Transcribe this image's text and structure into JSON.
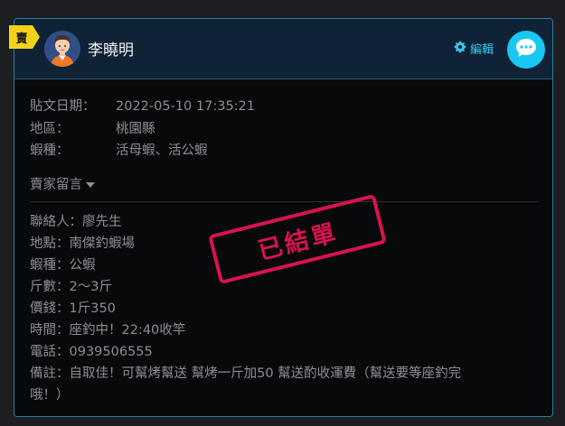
{
  "badge": {
    "label": "賣"
  },
  "seller": {
    "name": "李曉明"
  },
  "header": {
    "edit_label": "編輯",
    "edit_icon": "gear-icon",
    "chat_icon": "chat-bubble-icon"
  },
  "post_info": [
    {
      "label": "貼文日期：",
      "value": "2022-05-10 17:35:21"
    },
    {
      "label": "地區：",
      "value": "桃園縣"
    },
    {
      "label": "蝦種：",
      "value": "活母蝦、活公蝦"
    }
  ],
  "message_toggle": {
    "label": "賣家留言"
  },
  "stamp": {
    "text": "已結單"
  },
  "message_lines": [
    "聯絡人：廖先生",
    "地點：南傑釣蝦場",
    "蝦種：公蝦",
    "斤數：2～3斤",
    "價錢：1斤350",
    "時間：座釣中！22:40收竿",
    "電話：0939506555",
    "備註：自取佳！可幫烤幫送 幫烤一斤加50 幫送酌收運費（幫送要等座釣完",
    "哦！）"
  ],
  "colors": {
    "accent": "#18c8f0",
    "stamp": "#d8134e",
    "badge": "#f5d21a"
  }
}
